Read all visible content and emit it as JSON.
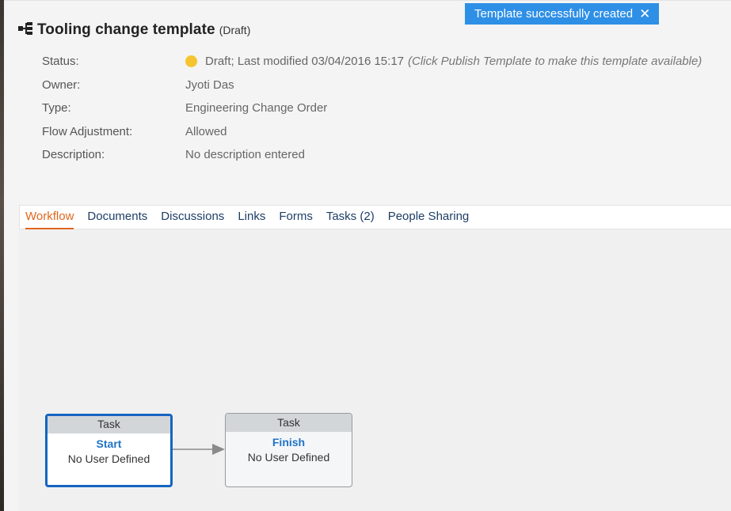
{
  "header": {
    "title": "Tooling change template",
    "title_state": "(Draft)",
    "toast": {
      "message": "Template successfully created",
      "close_glyph": "✕"
    }
  },
  "properties": [
    {
      "label": "Status:",
      "value": "Draft; Last modified 03/04/2016 15:17",
      "hint": "(Click Publish Template to make this template available)",
      "status_color": "#f5c431"
    },
    {
      "label": "Owner:",
      "value": "Jyoti Das"
    },
    {
      "label": "Type:",
      "value": "Engineering Change Order"
    },
    {
      "label": "Flow Adjustment:",
      "value": "Allowed"
    },
    {
      "label": "Description:",
      "value": "No description entered"
    }
  ],
  "tabs": [
    {
      "label": "Workflow",
      "active": true
    },
    {
      "label": "Documents"
    },
    {
      "label": "Discussions"
    },
    {
      "label": "Links"
    },
    {
      "label": "Forms"
    },
    {
      "label": "Tasks (2)"
    },
    {
      "label": "People Sharing"
    }
  ],
  "workflow": {
    "nodes": [
      {
        "type": "Task",
        "name": "Start",
        "user": "No User Defined",
        "selected": true
      },
      {
        "type": "Task",
        "name": "Finish",
        "user": "No User Defined",
        "selected": false
      }
    ]
  },
  "colors": {
    "accent": "#e0661d",
    "link": "#1d3e66",
    "toast": "#2e8fe6",
    "selected_border": "#1565c0",
    "status_draft": "#f5c431"
  },
  "icons": {
    "title_icon": "workflow-hierarchy-icon",
    "toast_close": "close-icon",
    "status": "status-dot-icon"
  }
}
